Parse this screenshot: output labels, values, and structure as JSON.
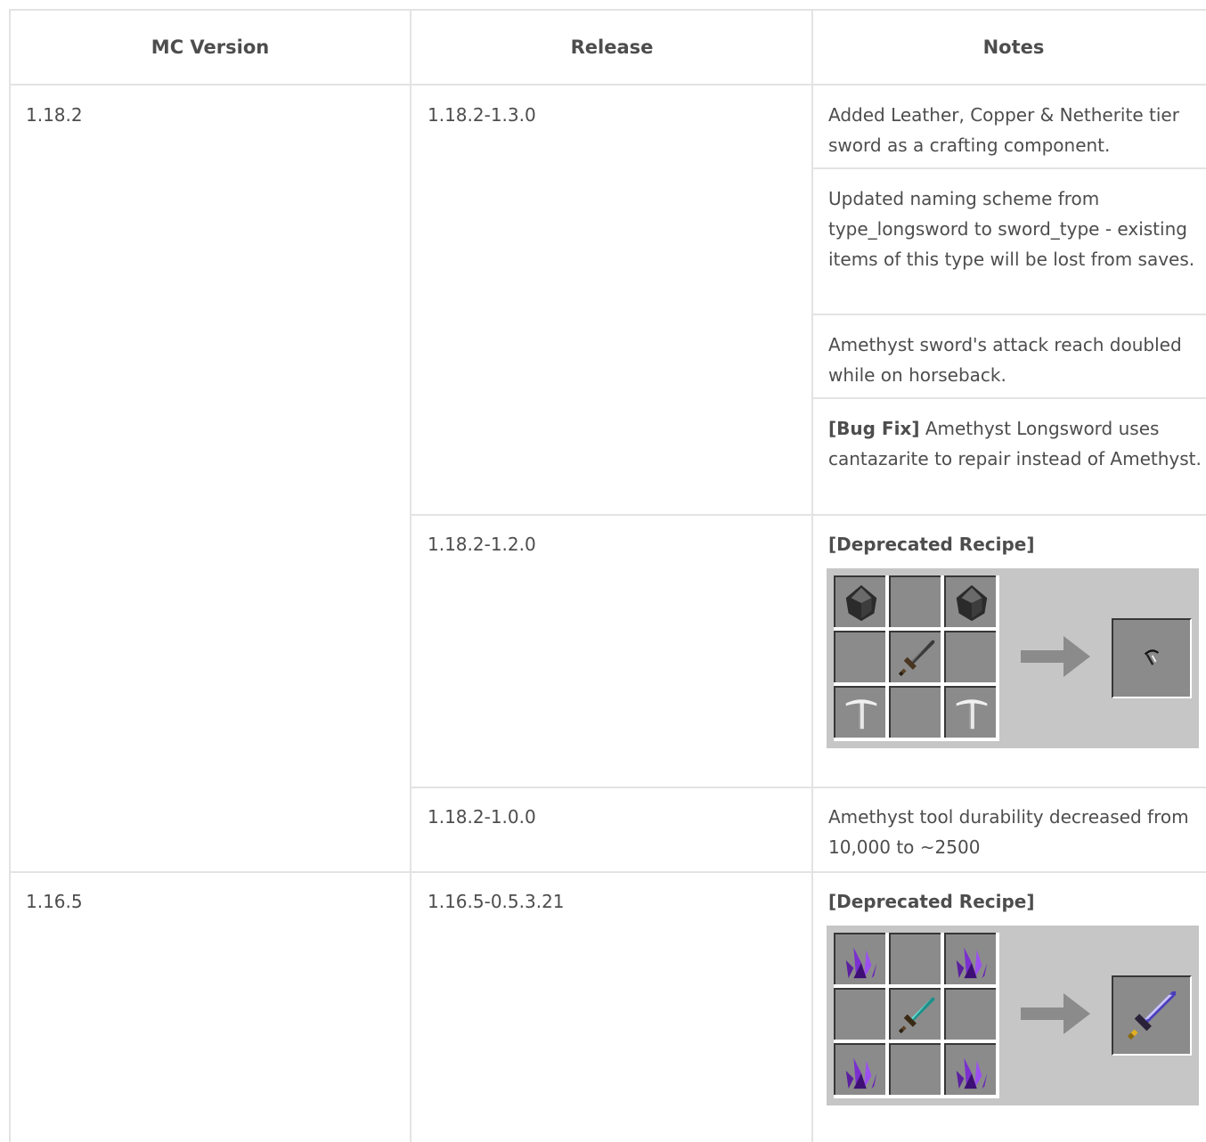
{
  "table": {
    "headers": [
      "MC Version",
      "Release",
      "Notes"
    ],
    "rows": [
      {
        "mc_version": "1.18.2",
        "releases": [
          {
            "release": "1.18.2-1.3.0",
            "notes": [
              {
                "text": "Added Leather, Copper & Netherite tier sword as a crafting component."
              },
              {
                "text": "Updated naming scheme from type_longsword to sword_type - existing items of this type will be lost from saves."
              },
              {
                "text": "Amethyst sword's attack reach doubled while on horseback."
              },
              {
                "tag": "[Bug Fix]",
                "text": " Amethyst Longsword uses cantazarite to repair instead of Amethyst."
              }
            ]
          },
          {
            "release": "1.18.2-1.2.0",
            "notes": [
              {
                "tag": "[Deprecated Recipe]",
                "recipe": {
                  "grid": [
                    "dark-gem-icon",
                    "empty",
                    "dark-gem-icon",
                    "empty",
                    "stone-sword-icon",
                    "empty",
                    "iron-pickaxe-icon",
                    "empty",
                    "iron-pickaxe-icon"
                  ],
                  "output": "small-tool-icon"
                }
              }
            ]
          },
          {
            "release": "1.18.2-1.0.0",
            "notes": [
              {
                "text": "Amethyst tool durability decreased from 10,000 to ~2500"
              }
            ]
          }
        ]
      },
      {
        "mc_version": "1.16.5",
        "releases": [
          {
            "release": "1.16.5-0.5.3.21",
            "notes": [
              {
                "tag": "[Deprecated Recipe]",
                "recipe": {
                  "grid": [
                    "amethyst-crystal-icon",
                    "empty",
                    "amethyst-crystal-icon",
                    "empty",
                    "diamond-sword-icon",
                    "empty",
                    "amethyst-crystal-icon",
                    "empty",
                    "amethyst-crystal-icon"
                  ],
                  "output": "amethyst-longsword-icon"
                }
              }
            ]
          }
        ]
      }
    ]
  }
}
